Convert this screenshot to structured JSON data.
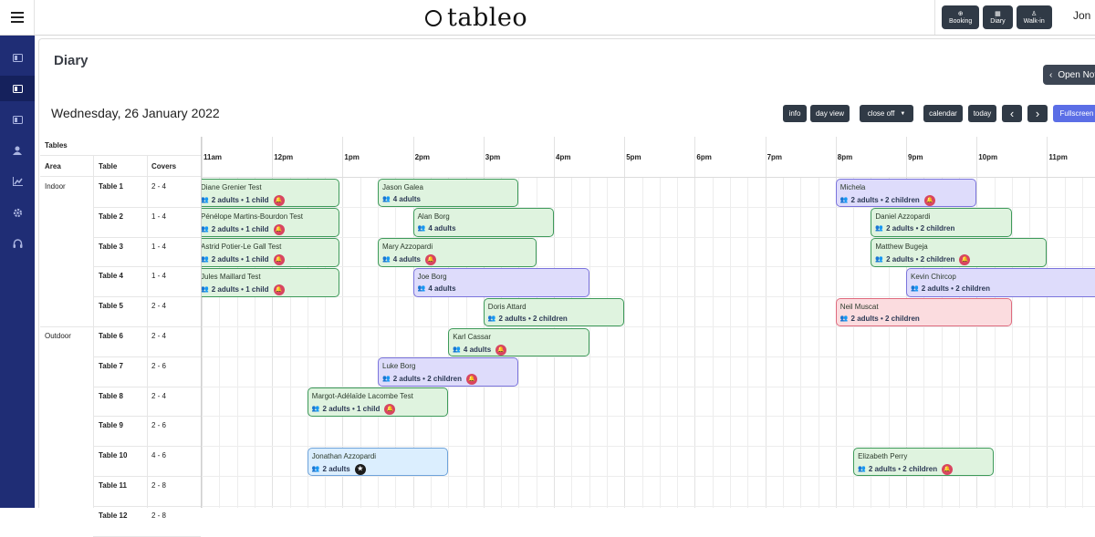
{
  "header": {
    "logo_text": "tableo",
    "actions": [
      {
        "label": "Booking",
        "icon": "plus-circle-icon"
      },
      {
        "label": "Diary",
        "icon": "calendar-icon"
      },
      {
        "label": "Walk-in",
        "icon": "walking-person-icon"
      }
    ],
    "user_name": "Jon"
  },
  "sidebar": {
    "items": [
      {
        "icon": "book-icon"
      },
      {
        "icon": "diary-icon",
        "active": true
      },
      {
        "icon": "book-open-icon"
      },
      {
        "icon": "user-icon"
      },
      {
        "icon": "chart-icon"
      },
      {
        "icon": "gear-icon"
      },
      {
        "icon": "headset-icon"
      }
    ]
  },
  "page": {
    "title": "Diary",
    "open_notes_label": "Open Not",
    "date": "Wednesday, 26 January 2022"
  },
  "toolbar": {
    "info": "info",
    "day_view": "day view",
    "close_off": "close off",
    "calendar": "calendar",
    "today": "today",
    "prev": "‹",
    "next": "›",
    "fullscreen": "Fullscreen"
  },
  "tables_panel": {
    "title": "Tables",
    "col_area": "Area",
    "col_table": "Table",
    "col_covers": "Covers",
    "rows": [
      {
        "area": "Indoor",
        "table": "Table 1",
        "covers": "2 - 4"
      },
      {
        "area": "",
        "table": "Table 2",
        "covers": "1 - 4"
      },
      {
        "area": "",
        "table": "Table 3",
        "covers": "1 - 4"
      },
      {
        "area": "",
        "table": "Table 4",
        "covers": "1 - 4"
      },
      {
        "area": "",
        "table": "Table 5",
        "covers": "2 - 4"
      },
      {
        "area": "Outdoor",
        "table": "Table 6",
        "covers": "2 - 4"
      },
      {
        "area": "",
        "table": "Table 7",
        "covers": "2 - 6"
      },
      {
        "area": "",
        "table": "Table 8",
        "covers": "2 - 4"
      },
      {
        "area": "",
        "table": "Table 9",
        "covers": "2 - 6"
      },
      {
        "area": "",
        "table": "Table 10",
        "covers": "4 - 6"
      },
      {
        "area": "",
        "table": "Table 11",
        "covers": "2 - 8"
      },
      {
        "area": "",
        "table": "Table 12",
        "covers": "2 - 8"
      }
    ]
  },
  "timeline": {
    "hours": [
      "11am",
      "12pm",
      "1pm",
      "2pm",
      "3pm",
      "4pm",
      "5pm",
      "6pm",
      "7pm",
      "8pm",
      "9pm",
      "10pm",
      "11pm"
    ]
  },
  "bookings": [
    {
      "name": "Diane Grenier Test",
      "info": "2 adults • 1 child",
      "row": 0,
      "start": 11.0,
      "end": 12.95,
      "color": "green",
      "badge": "bell"
    },
    {
      "name": "Jason Galea",
      "info": "4 adults",
      "row": 0,
      "start": 13.5,
      "end": 15.5,
      "color": "green",
      "badge": ""
    },
    {
      "name": "Michela",
      "info": "2 adults • 2 children",
      "row": 0,
      "start": 20.0,
      "end": 22.0,
      "color": "purple",
      "badge": "bell"
    },
    {
      "name": "Pénélope Martins-Bourdon Test",
      "info": "2 adults • 1 child",
      "row": 1,
      "start": 11.0,
      "end": 12.95,
      "color": "green",
      "badge": "bell"
    },
    {
      "name": "Alan Borg",
      "info": "4 adults",
      "row": 1,
      "start": 14.0,
      "end": 16.0,
      "color": "green",
      "badge": ""
    },
    {
      "name": "Daniel Azzopardi",
      "info": "2 adults • 2 children",
      "row": 1,
      "start": 20.5,
      "end": 22.5,
      "color": "green",
      "badge": ""
    },
    {
      "name": "Astrid Potier-Le Gall Test",
      "info": "2 adults • 1 child",
      "row": 2,
      "start": 11.0,
      "end": 12.95,
      "color": "green",
      "badge": "bell"
    },
    {
      "name": "Mary Azzopardi",
      "info": "4 adults",
      "row": 2,
      "start": 13.5,
      "end": 15.75,
      "color": "green",
      "badge": "bell"
    },
    {
      "name": "Matthew Bugeja",
      "info": "2 adults • 2 children",
      "row": 2,
      "start": 20.5,
      "end": 23.0,
      "color": "green",
      "badge": "bell"
    },
    {
      "name": "Jules Maillard Test",
      "info": "2 adults • 1 child",
      "row": 3,
      "start": 11.0,
      "end": 12.95,
      "color": "green",
      "badge": "bell"
    },
    {
      "name": "Joe Borg",
      "info": "4 adults",
      "row": 3,
      "start": 14.0,
      "end": 16.5,
      "color": "purple",
      "badge": ""
    },
    {
      "name": "Kevin Chircop",
      "info": "2 adults • 2 children",
      "row": 3,
      "start": 21.0,
      "end": 24.0,
      "color": "purple",
      "badge": ""
    },
    {
      "name": "Doris Attard",
      "info": "2 adults • 2 children",
      "row": 4,
      "start": 15.0,
      "end": 17.0,
      "color": "green",
      "badge": ""
    },
    {
      "name": "Neil Muscat",
      "info": "2 adults • 2 children",
      "row": 4,
      "start": 20.0,
      "end": 22.5,
      "color": "pink",
      "badge": ""
    },
    {
      "name": "Karl Cassar",
      "info": "4 adults",
      "row": 5,
      "start": 14.5,
      "end": 16.5,
      "color": "green",
      "badge": "bell"
    },
    {
      "name": "Luke Borg",
      "info": "2 adults • 2 children",
      "row": 6,
      "start": 13.5,
      "end": 15.5,
      "color": "purple",
      "badge": "bell"
    },
    {
      "name": "Margot-Adélaïde Lacombe Test",
      "info": "2 adults • 1 child",
      "row": 7,
      "start": 12.5,
      "end": 14.5,
      "color": "green",
      "badge": "bell"
    },
    {
      "name": "Jonathan Azzopardi",
      "info": "2 adults",
      "row": 9,
      "start": 12.5,
      "end": 14.5,
      "color": "blue",
      "badge": "star"
    },
    {
      "name": "Elizabeth Perry",
      "info": "2 adults • 2 children",
      "row": 9,
      "start": 20.25,
      "end": 22.25,
      "color": "green",
      "badge": "bell"
    }
  ]
}
